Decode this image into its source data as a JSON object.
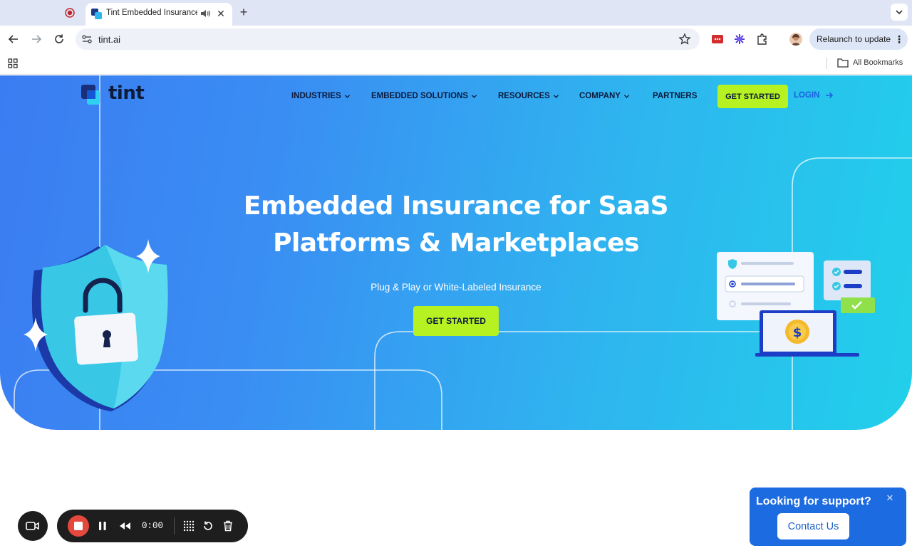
{
  "browser": {
    "tab": {
      "title": "Tint Embedded Insurance"
    },
    "address": {
      "url": "tint.ai"
    },
    "relaunch_label": "Relaunch to update",
    "bookmarks_label": "All Bookmarks",
    "icons": [
      "record-icon",
      "tint-favicon",
      "speaker-icon",
      "close-icon",
      "plus-icon",
      "chevron-down-icon",
      "back-icon",
      "forward-icon",
      "reload-icon",
      "site-info-icon",
      "star-icon",
      "extension-icon",
      "puzzle-icon",
      "avatar",
      "kebab-icon",
      "apps-grid-icon",
      "folder-icon"
    ]
  },
  "site": {
    "brand": "tint",
    "nav": {
      "industries": "INDUSTRIES",
      "embedded_solutions": "EMBEDDED SOLUTIONS",
      "resources": "RESOURCES",
      "company": "COMPANY",
      "partners": "PARTNERS",
      "get_started": "GET STARTED",
      "login": "LOGIN"
    },
    "hero": {
      "title_line1": "Embedded Insurance for SaaS",
      "title_line2": "Platforms & Marketplaces",
      "subtitle": "Plug & Play or White-Labeled Insurance",
      "cta": "GET STARTED"
    },
    "colors": {
      "accent": "#b6f222",
      "gradient_start": "#3b7cf2",
      "gradient_end": "#21d0ea",
      "brand_dark": "#0c1a3d",
      "login": "#1a5fe0"
    }
  },
  "recorder": {
    "time": "0:00",
    "icons": [
      "camera-icon",
      "stop-icon",
      "pause-icon",
      "rewind-icon",
      "grid-icon",
      "restart-icon",
      "trash-icon"
    ]
  },
  "support": {
    "title": "Looking for support?",
    "button": "Contact Us",
    "color": "#1c6be0"
  }
}
